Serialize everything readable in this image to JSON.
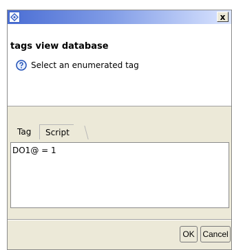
{
  "window": {
    "title": "",
    "close_label": "x"
  },
  "header": {
    "title": "tags view database",
    "message": "Select an enumerated tag"
  },
  "tabs": [
    {
      "label": "Tag"
    },
    {
      "label": "Script"
    }
  ],
  "editor": {
    "text": "DO1@ = 1"
  },
  "buttons": {
    "ok": "OK",
    "cancel": "Cancel"
  },
  "icons": {
    "app": "app-icon",
    "help": "help-icon",
    "close": "close-icon"
  },
  "colors": {
    "title_gradient_start": "#4b6ed4",
    "title_gradient_end": "#dbe5ff",
    "dialog_bg": "#ece9d8"
  }
}
